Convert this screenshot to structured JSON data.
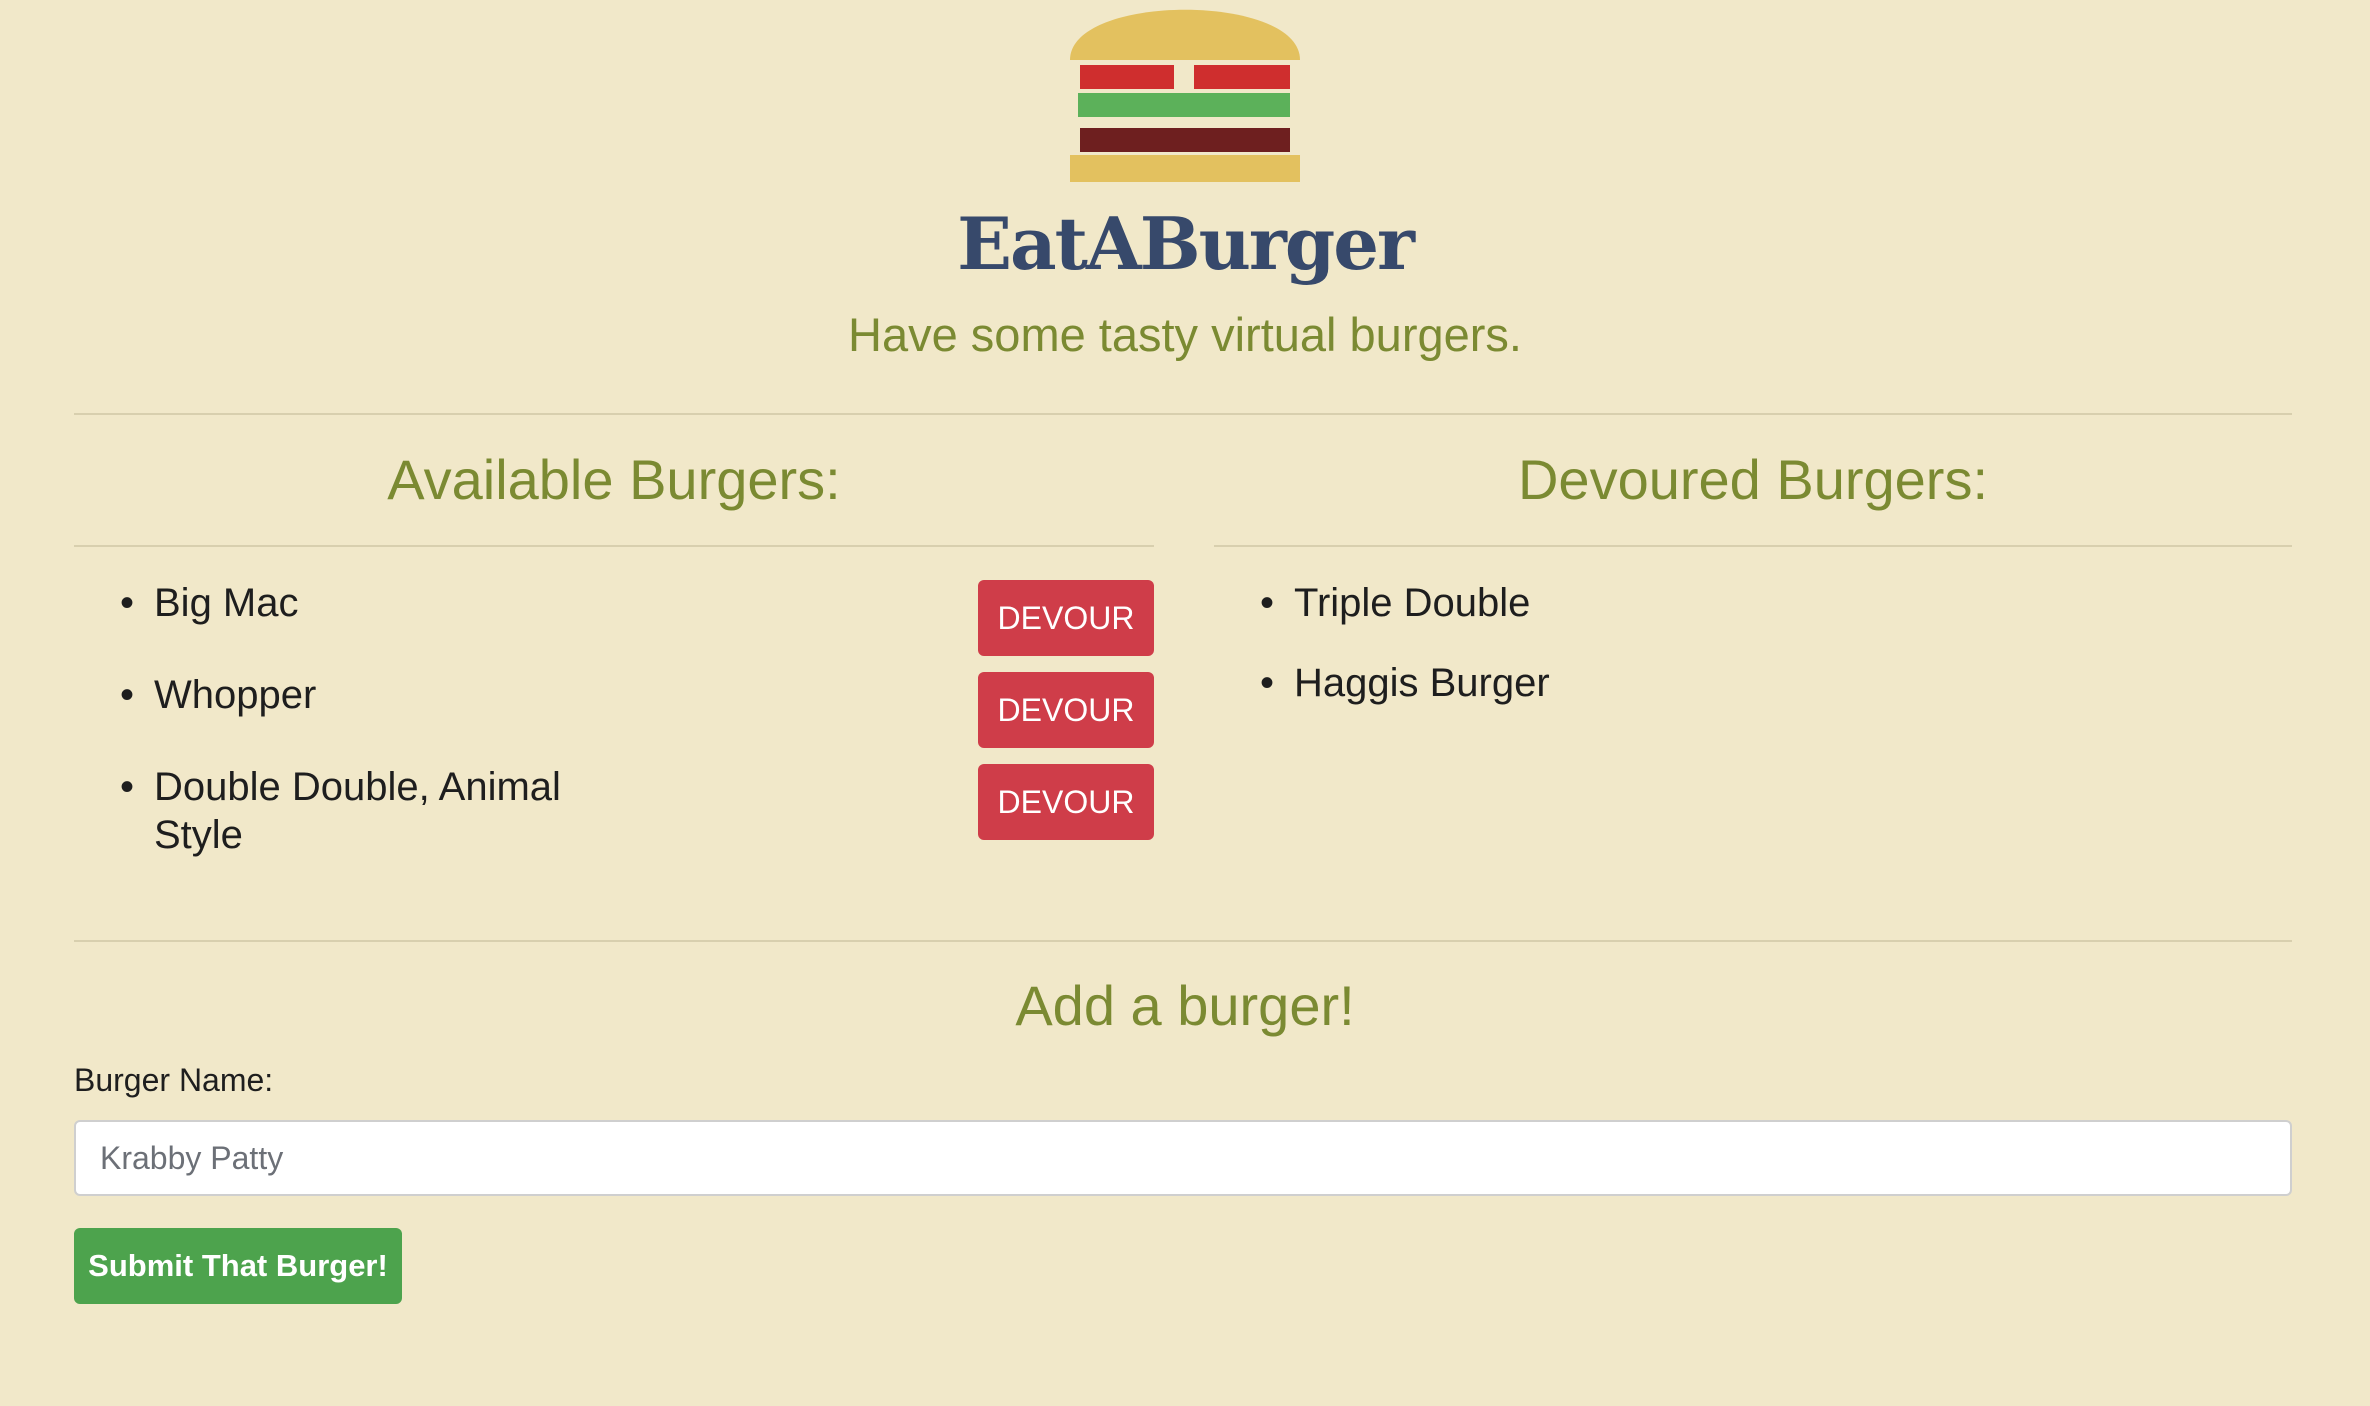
{
  "header": {
    "brand": "EatABurger",
    "tagline": "Have some tasty virtual burgers."
  },
  "available": {
    "title": "Available Burgers:",
    "button_label": "DEVOUR",
    "items": [
      {
        "name": "Big Mac"
      },
      {
        "name": "Whopper"
      },
      {
        "name": "Double Double, Animal Style"
      }
    ]
  },
  "devoured": {
    "title": "Devoured Burgers:",
    "items": [
      {
        "name": "Triple Double"
      },
      {
        "name": "Haggis Burger"
      }
    ]
  },
  "add_form": {
    "title": "Add a burger!",
    "field_label": "Burger Name:",
    "placeholder": "Krabby Patty",
    "submit_label": "Submit That Burger!"
  },
  "colors": {
    "background": "#f1e8c9",
    "brand": "#37496b",
    "accent_text": "#7b8a32",
    "devour_button": "#cf3d49",
    "submit_button": "#4da34d",
    "bun": "#e3c15f",
    "tomato": "#cf2e2e",
    "lettuce": "#5cb15a",
    "patty": "#6e1f1f"
  }
}
